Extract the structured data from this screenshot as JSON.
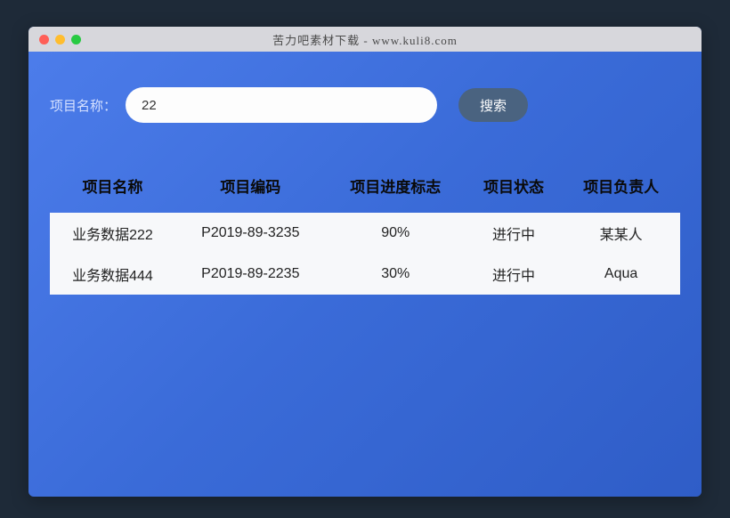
{
  "window": {
    "title": "苦力吧素材下载 - www.kuli8.com"
  },
  "search": {
    "label": "项目名称：",
    "value": "22",
    "button": "搜索"
  },
  "table": {
    "headers": [
      "项目名称",
      "项目编码",
      "项目进度标志",
      "项目状态",
      "项目负责人"
    ],
    "rows": [
      {
        "name": "业务数据222",
        "code": "P2019-89-3235",
        "progress": "90%",
        "status": "进行中",
        "owner": "某某人"
      },
      {
        "name": "业务数据444",
        "code": "P2019-89-2235",
        "progress": "30%",
        "status": "进行中",
        "owner": "Aqua"
      }
    ]
  }
}
